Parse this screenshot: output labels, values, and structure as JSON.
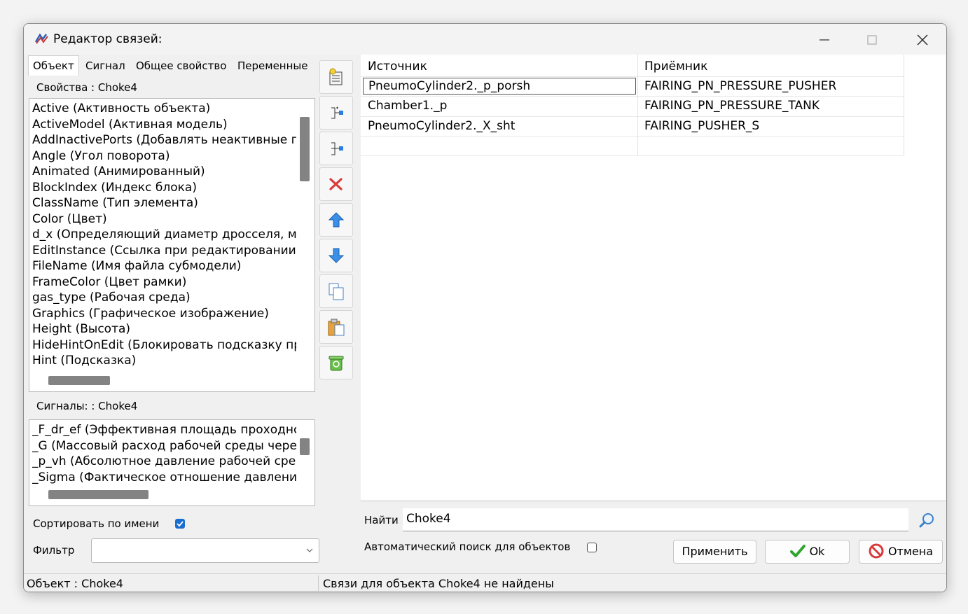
{
  "window": {
    "title": "Редактор связей:",
    "controls": [
      "minimize-icon",
      "maximize-icon",
      "close-icon"
    ]
  },
  "tabs": [
    {
      "label": "Объект",
      "active": true
    },
    {
      "label": "Сигнал",
      "active": false
    },
    {
      "label": "Общее свойство",
      "active": false
    },
    {
      "label": "Переменные",
      "active": false
    }
  ],
  "properties": {
    "label": "Свойства : Choke4",
    "items": [
      "Active  (Активность объекта)",
      "ActiveModel  (Активная модель)",
      "AddInactivePorts  (Добавлять неактивные пс",
      "Angle  (Угол поворота)",
      "Animated  (Анимированный)",
      "BlockIndex  (Индекс блока)",
      "ClassName  (Тип элемента)",
      "Color  (Цвет)",
      "d_x  (Определяющий диаметр дросселя, м)",
      "EditInstance  (Ссылка при редактировании)",
      "FileName  (Имя файла субмодели)",
      "FrameColor  (Цвет рамки)",
      "gas_type  (Рабочая среда)",
      "Graphics  (Графическое изображение)",
      "Height  (Высота)",
      "HideHintOnEdit  (Блокировать подсказку при",
      "Hint  (Подсказка)"
    ]
  },
  "signals": {
    "label": "Сигналы: : Choke4",
    "items": [
      "_F_dr_ef  (Эффективная площадь проходнс",
      "_G  (Массовый расход рабочей среды через",
      "_p_vh  (Абсолютное давление рабочей сред",
      "_Sigma  (Фактическое отношение давлени"
    ]
  },
  "sort": {
    "label": "Сортировать по имени",
    "checked": true
  },
  "filter": {
    "label": "Фильтр",
    "value": ""
  },
  "toolbar": [
    {
      "icon": "properties-edit-icon"
    },
    {
      "icon": "add-link-icon"
    },
    {
      "icon": "insert-link-icon"
    },
    {
      "icon": "delete-icon"
    },
    {
      "icon": "move-up-icon"
    },
    {
      "icon": "move-down-icon"
    },
    {
      "icon": "copy-icon"
    },
    {
      "icon": "paste-icon"
    },
    {
      "icon": "trash-icon"
    }
  ],
  "table": {
    "headers": [
      "Источник",
      "Приёмник"
    ],
    "rows": [
      {
        "source": "PneumoCylinder2._p_porsh",
        "target": "FAIRING_PN_PRESSURE_PUSHER",
        "selected": true
      },
      {
        "source": "Chamber1._p",
        "target": "FAIRING_PN_PRESSURE_TANK",
        "selected": false
      },
      {
        "source": "PneumoCylinder2._X_sht",
        "target": "FAIRING_PUSHER_S",
        "selected": false
      }
    ]
  },
  "search": {
    "label": "Найти",
    "value": "Choke4"
  },
  "auto_search": {
    "label": "Автоматический  поиск  для  объектов",
    "checked": false
  },
  "buttons": {
    "apply": "Применить",
    "ok": "Ok",
    "cancel": "Отмена"
  },
  "status": {
    "left": "Объект : Choke4",
    "right": "Связи для объекта  Choke4  не найдены"
  },
  "colors": {
    "accent": "#1a6ecf",
    "cancel_red": "#d83b3b",
    "ok_green": "#2fa52f"
  }
}
